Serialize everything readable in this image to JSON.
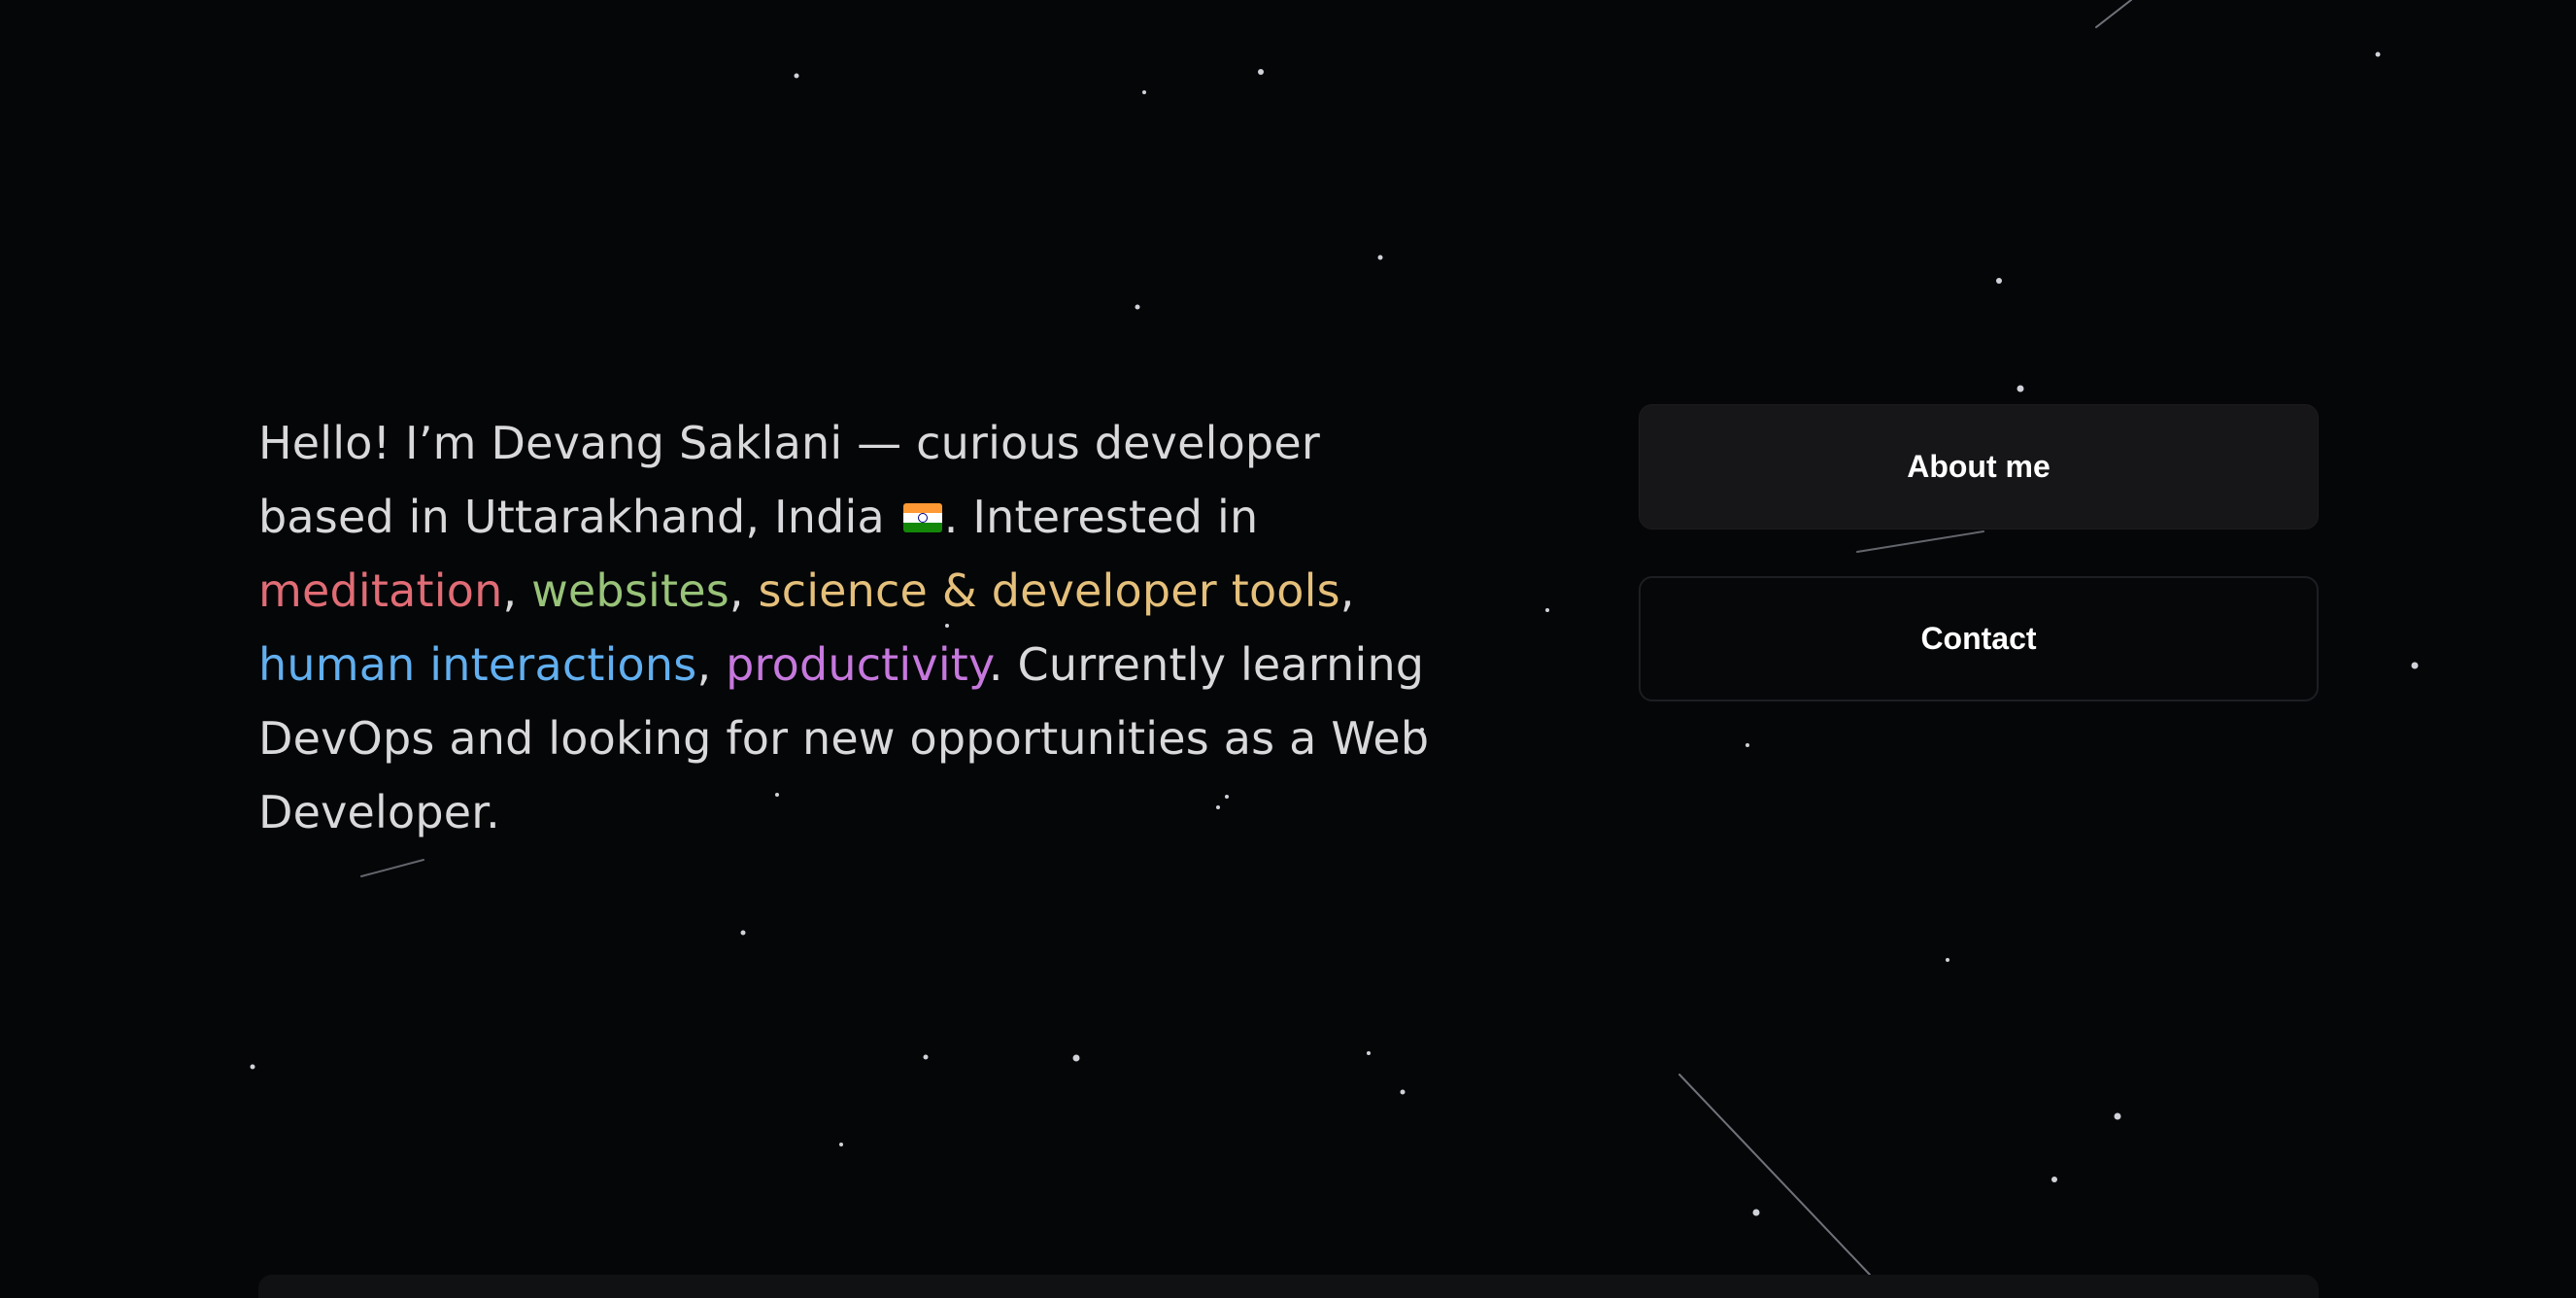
{
  "intro": {
    "part1": "Hello! I’m Devang Saklani — curious developer based in Uttarakhand, India",
    "part2": ". Interested in ",
    "topics": {
      "meditation": "meditation",
      "websites": "websites",
      "science": "science & developer tools",
      "human": "human interactions",
      "productivity": "productivity"
    },
    "sep": ", ",
    "part3": ". Currently learning DevOps and looking for new opportunities as a Web Developer.",
    "flag_icon": "india-flag-icon"
  },
  "buttons": {
    "about_label": "About me",
    "contact_label": "Contact"
  },
  "colors": {
    "background": "#050608",
    "text": "#d9d9dc",
    "meditation": "#e06c75",
    "websites": "#98c379",
    "science": "#e5c07b",
    "human": "#61afef",
    "productivity": "#c678dd",
    "about_button_bg": "#161618",
    "contact_button_border": "#1d1e22"
  }
}
